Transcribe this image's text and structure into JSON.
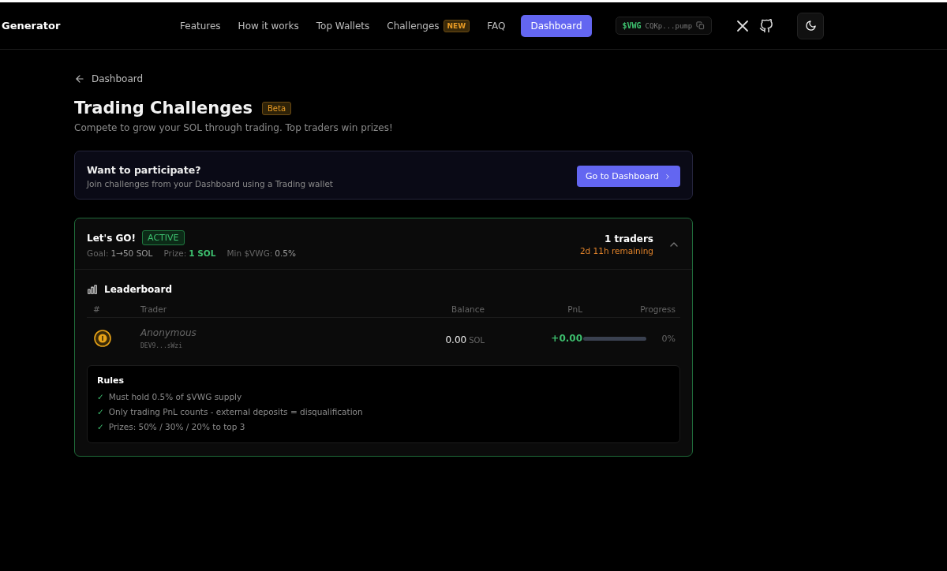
{
  "header": {
    "brand": "Generator",
    "nav": [
      {
        "label": "Features",
        "kind": "link"
      },
      {
        "label": "How it works",
        "kind": "link"
      },
      {
        "label": "Top Wallets",
        "kind": "link"
      },
      {
        "label": "Challenges",
        "kind": "link",
        "badge": "NEW"
      },
      {
        "label": "FAQ",
        "kind": "link"
      },
      {
        "label": "Dashboard",
        "kind": "button"
      }
    ],
    "token": {
      "symbol": "$VWG",
      "address": "CQKp...pump"
    }
  },
  "back_link": "Dashboard",
  "page": {
    "title": "Trading Challenges",
    "badge": "Beta",
    "subtitle": "Compete to grow your SOL through trading. Top traders win prizes!"
  },
  "cta": {
    "title": "Want to participate?",
    "text": "Join challenges from your Dashboard using a Trading wallet",
    "button": "Go to Dashboard"
  },
  "challenge": {
    "name": "Let's GO!",
    "status": "ACTIVE",
    "expanded": true,
    "meta": [
      {
        "label": "Goal:",
        "value": "1→50 SOL",
        "highlight": false
      },
      {
        "label": "Prize:",
        "value": "1 SOL",
        "highlight": true
      },
      {
        "label": "Min $VWG:",
        "value": "0.5%",
        "highlight": false
      }
    ],
    "traders": "1 traders",
    "remaining": "2d 11h remaining",
    "leaderboard": {
      "title": "Leaderboard",
      "columns": [
        "#",
        "Trader",
        "Balance",
        "PnL",
        "Progress"
      ],
      "rows": [
        {
          "name": "Anonymous",
          "wallet": "DEV9...sWzi",
          "balance": "0.00",
          "unit": "SOL",
          "pnl": "+0.00",
          "level": 0,
          "progress": "0%"
        }
      ]
    },
    "rules": {
      "title": "Rules",
      "items": [
        {
          "mark": "✓",
          "text": "Must hold 0.5% of $VWG supply"
        },
        {
          "mark": "✓",
          "text": "Only trading PnL counts - external deposits = disqualification"
        },
        {
          "mark": "✓",
          "text": "Prizes: 50% / 30% / 20% to top 3"
        }
      ]
    }
  }
}
